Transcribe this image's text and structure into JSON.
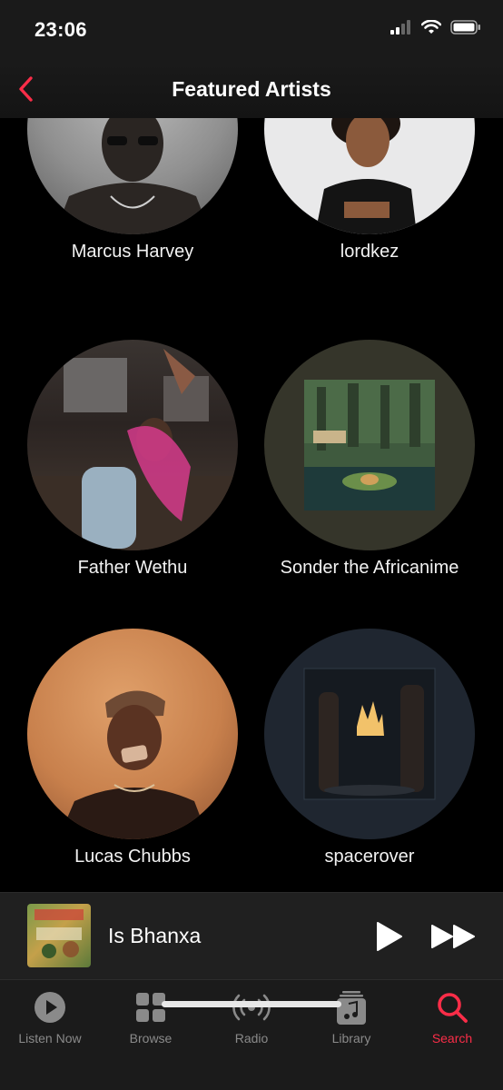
{
  "status_bar": {
    "time": "23:06",
    "signal_icon": "cellular-signal-icon",
    "wifi_icon": "wifi-icon",
    "battery_icon": "battery-icon"
  },
  "nav": {
    "back_icon": "chevron-left-icon",
    "title": "Featured Artists"
  },
  "colors": {
    "accent": "#fa2d48",
    "background": "#000000",
    "tab_inactive": "#8a8a8a"
  },
  "artists": [
    {
      "name": "Marcus Harvey"
    },
    {
      "name": "lordkez"
    },
    {
      "name": "Father Wethu"
    },
    {
      "name": "Sonder the Africanime"
    },
    {
      "name": "Lucas Chubbs"
    },
    {
      "name": "spacerover"
    }
  ],
  "mini_player": {
    "title": "Is Bhanxa",
    "play_icon": "play-icon",
    "forward_icon": "fast-forward-icon"
  },
  "tabs": [
    {
      "label": "Listen Now",
      "icon": "play-circle-icon",
      "active": false
    },
    {
      "label": "Browse",
      "icon": "grid-icon",
      "active": false
    },
    {
      "label": "Radio",
      "icon": "radio-waves-icon",
      "active": false
    },
    {
      "label": "Library",
      "icon": "music-library-icon",
      "active": false
    },
    {
      "label": "Search",
      "icon": "search-icon",
      "active": true
    }
  ]
}
